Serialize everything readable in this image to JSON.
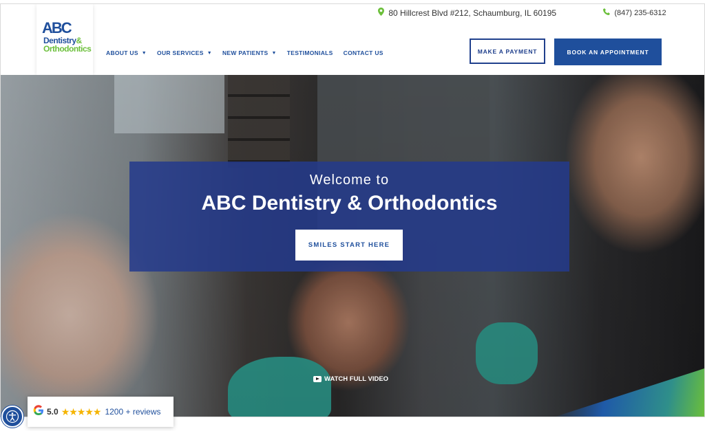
{
  "logo": {
    "abc": "ABC",
    "line1": "Dentistry",
    "amp": "&",
    "line2": "Orthodontics"
  },
  "topbar": {
    "address": "80 Hillcrest Blvd #212, Schaumburg, IL 60195",
    "phone": "(847) 235-6312"
  },
  "nav": {
    "items": [
      {
        "label": "ABOUT US",
        "dropdown": true
      },
      {
        "label": "OUR SERVICES",
        "dropdown": true
      },
      {
        "label": "NEW PATIENTS",
        "dropdown": true
      },
      {
        "label": "TESTIMONIALS",
        "dropdown": false
      },
      {
        "label": "CONTACT US",
        "dropdown": false
      }
    ]
  },
  "buttons": {
    "payment": "MAKE A PAYMENT",
    "book": "BOOK AN APPOINTMENT"
  },
  "hero": {
    "welcome": "Welcome to",
    "title": "ABC Dentistry & Orthodontics",
    "cta": "SMILES START HERE",
    "video": "WATCH FULL VIDEO"
  },
  "reviews": {
    "rating": "5.0",
    "stars": "★★★★★",
    "count": "1200 + reviews"
  },
  "colors": {
    "brand_blue": "#1f4f9c",
    "brand_green": "#6bbf3a",
    "panel": "#243a8c"
  }
}
